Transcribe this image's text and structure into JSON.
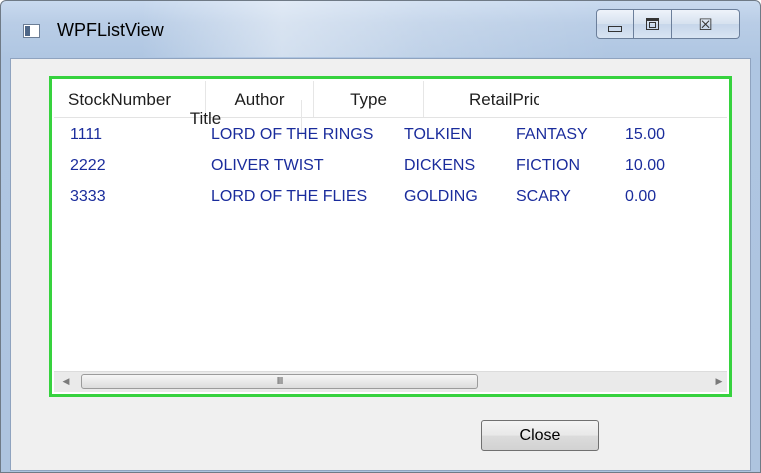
{
  "window": {
    "title": "WPFListView",
    "icon": "app-window-icon",
    "controls": {
      "minimize_icon": "minimize-icon",
      "maximize_icon": "maximize-icon",
      "close_glyph": "☒"
    }
  },
  "listview": {
    "border_color": "#36d23e",
    "text_color": "#1a2c9c",
    "columns": [
      "StockNumber",
      "Title",
      "Author",
      "Type",
      "RetailPric"
    ],
    "rows": [
      {
        "stock": "1111",
        "title": "LORD OF THE RINGS",
        "author": "TOLKIEN",
        "type": "FANTASY",
        "price": "15.00"
      },
      {
        "stock": "2222",
        "title": "OLIVER TWIST",
        "author": "DICKENS",
        "type": "FICTION",
        "price": "10.00"
      },
      {
        "stock": "3333",
        "title": "LORD OF THE FLIES",
        "author": "GOLDING",
        "type": "SCARY",
        "price": "0.00"
      }
    ],
    "scrollbar": {
      "left_arrow": "◀",
      "right_arrow": "▶",
      "grip": "III"
    }
  },
  "footer": {
    "close_label": "Close"
  }
}
